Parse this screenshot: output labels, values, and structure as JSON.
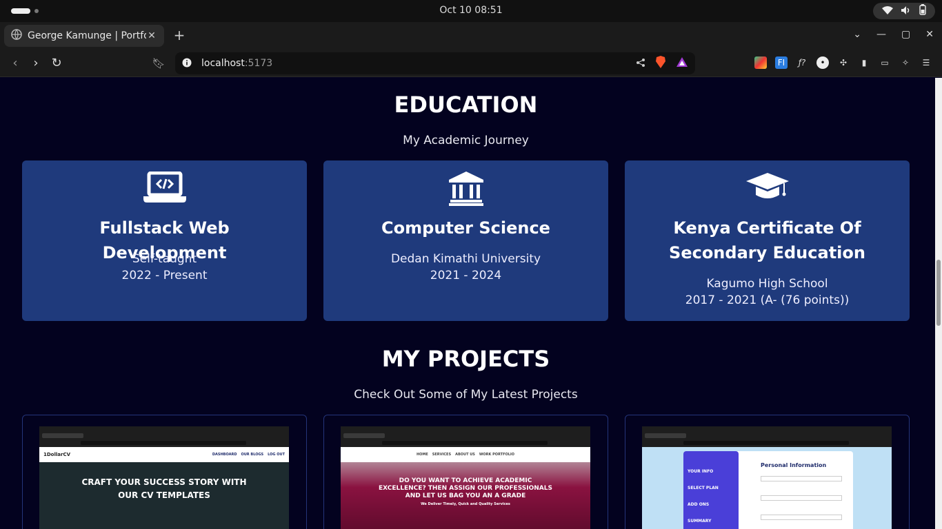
{
  "os": {
    "clock": "Oct 10  08:51"
  },
  "browser": {
    "tab_title": "George Kamunge | Portfolio",
    "url_host": "localhost",
    "url_port": ":5173"
  },
  "education": {
    "title": "EDUCATION",
    "subtitle": "My Academic Journey",
    "cards": [
      {
        "icon": "laptop-code-icon",
        "title": "Fullstack Web Development",
        "line1": "Self-taught",
        "line2": "2022 - Present"
      },
      {
        "icon": "university-icon",
        "title": "Computer Science",
        "line1": "Dedan Kimathi University",
        "line2": "2021 - 2024"
      },
      {
        "icon": "graduation-cap-icon",
        "title": "Kenya Certificate Of Secondary Education",
        "line1": "Kagumo High School",
        "line2": "2017 - 2021 (A- (76 points))"
      }
    ]
  },
  "projects": {
    "title": "MY PROJECTS",
    "subtitle": "Check Out Some of My Latest Projects",
    "items": [
      {
        "brand": "1DollarCV",
        "nav": [
          "DASHBOARD",
          "OUR BLOGS",
          "LOG OUT"
        ],
        "hero": "CRAFT YOUR SUCCESS STORY WITH OUR CV TEMPLATES",
        "colors": {
          "bg": "#1d2b2f"
        }
      },
      {
        "brand": "",
        "nav": [
          "HOME",
          "SERVICES",
          "ABOUT US",
          "WORK PORTFOLIO"
        ],
        "hero": "DO YOU WANT TO ACHIEVE ACADEMIC EXCELLENCE? THEN ASSIGN OUR PROFESSIONALS AND LET US BAG YOU AN A GRADE",
        "tagline": "We Deliver Timely, Quick and Quality Services",
        "colors": {
          "bg": "#8a1240"
        }
      },
      {
        "brand": "",
        "hero": "Personal Information",
        "steps": [
          "YOUR INFO",
          "SELECT PLAN",
          "ADD ONS",
          "SUMMARY"
        ],
        "colors": {
          "bg": "#bfe0f5",
          "accent": "#4a3fd8"
        }
      }
    ]
  }
}
